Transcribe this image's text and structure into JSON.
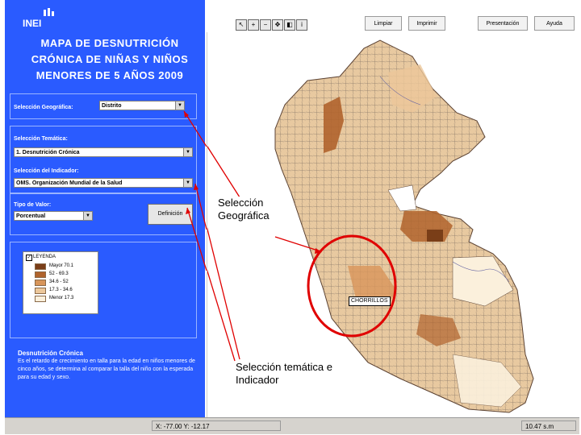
{
  "sidebar": {
    "logo": "INEI",
    "title_lines": [
      "MAPA DE DESNUTRICIÓN",
      "CRÓNICA DE NIÑAS Y NIÑOS",
      "MENORES DE 5 AÑOS  2009"
    ],
    "geo_label": "Selección Geográfica:",
    "geo_value": "Distrito",
    "tematica_label": "Selección Temática:",
    "tematica_value": "1. Desnutrición Crónica",
    "indicador_label": "Selección del Indicador:",
    "indicador_value": "OMS. Organización Mundial de la Salud",
    "tipo_label": "Tipo de Valor:",
    "tipo_value": "Porcentual",
    "definicion_button": "Definición",
    "legend_title": "LEYENDA",
    "legend_items": [
      {
        "text": "Mayor 70.1",
        "color": "#7a3e18"
      },
      {
        "text": "52 - 69.3",
        "color": "#b0632c"
      },
      {
        "text": "34.6 - 52",
        "color": "#d8955a"
      },
      {
        "text": "17.3 - 34.6",
        "color": "#ecc79a"
      },
      {
        "text": "Menor 17.3",
        "color": "#fbf0dc"
      }
    ],
    "desc_title": "Desnutrición Crónica",
    "desc_text": "Es el retardo de crecimiento en talla para la edad en niños menores de cinco años, se determina al comparar la talla del niño con la esperada para su edad y sexo."
  },
  "toolbar": {
    "buttons": [
      "Limpiar",
      "Imprimir",
      "Presentación",
      "Ayuda"
    ],
    "tool_icons": [
      "pointer-icon",
      "zoom-in-icon",
      "zoom-out-icon",
      "pan-icon",
      "identify-icon",
      "info-icon"
    ]
  },
  "map": {
    "place_label": "CHORRILLOS",
    "callout_geo": [
      "Selección",
      "Geográfica"
    ],
    "callout_tem": [
      "Selección temática e",
      "Indicador"
    ],
    "annotation_color": "#e00000"
  },
  "status": {
    "coords": "X: -77.00   Y: -12.17",
    "scale": "10.47 s.m"
  }
}
